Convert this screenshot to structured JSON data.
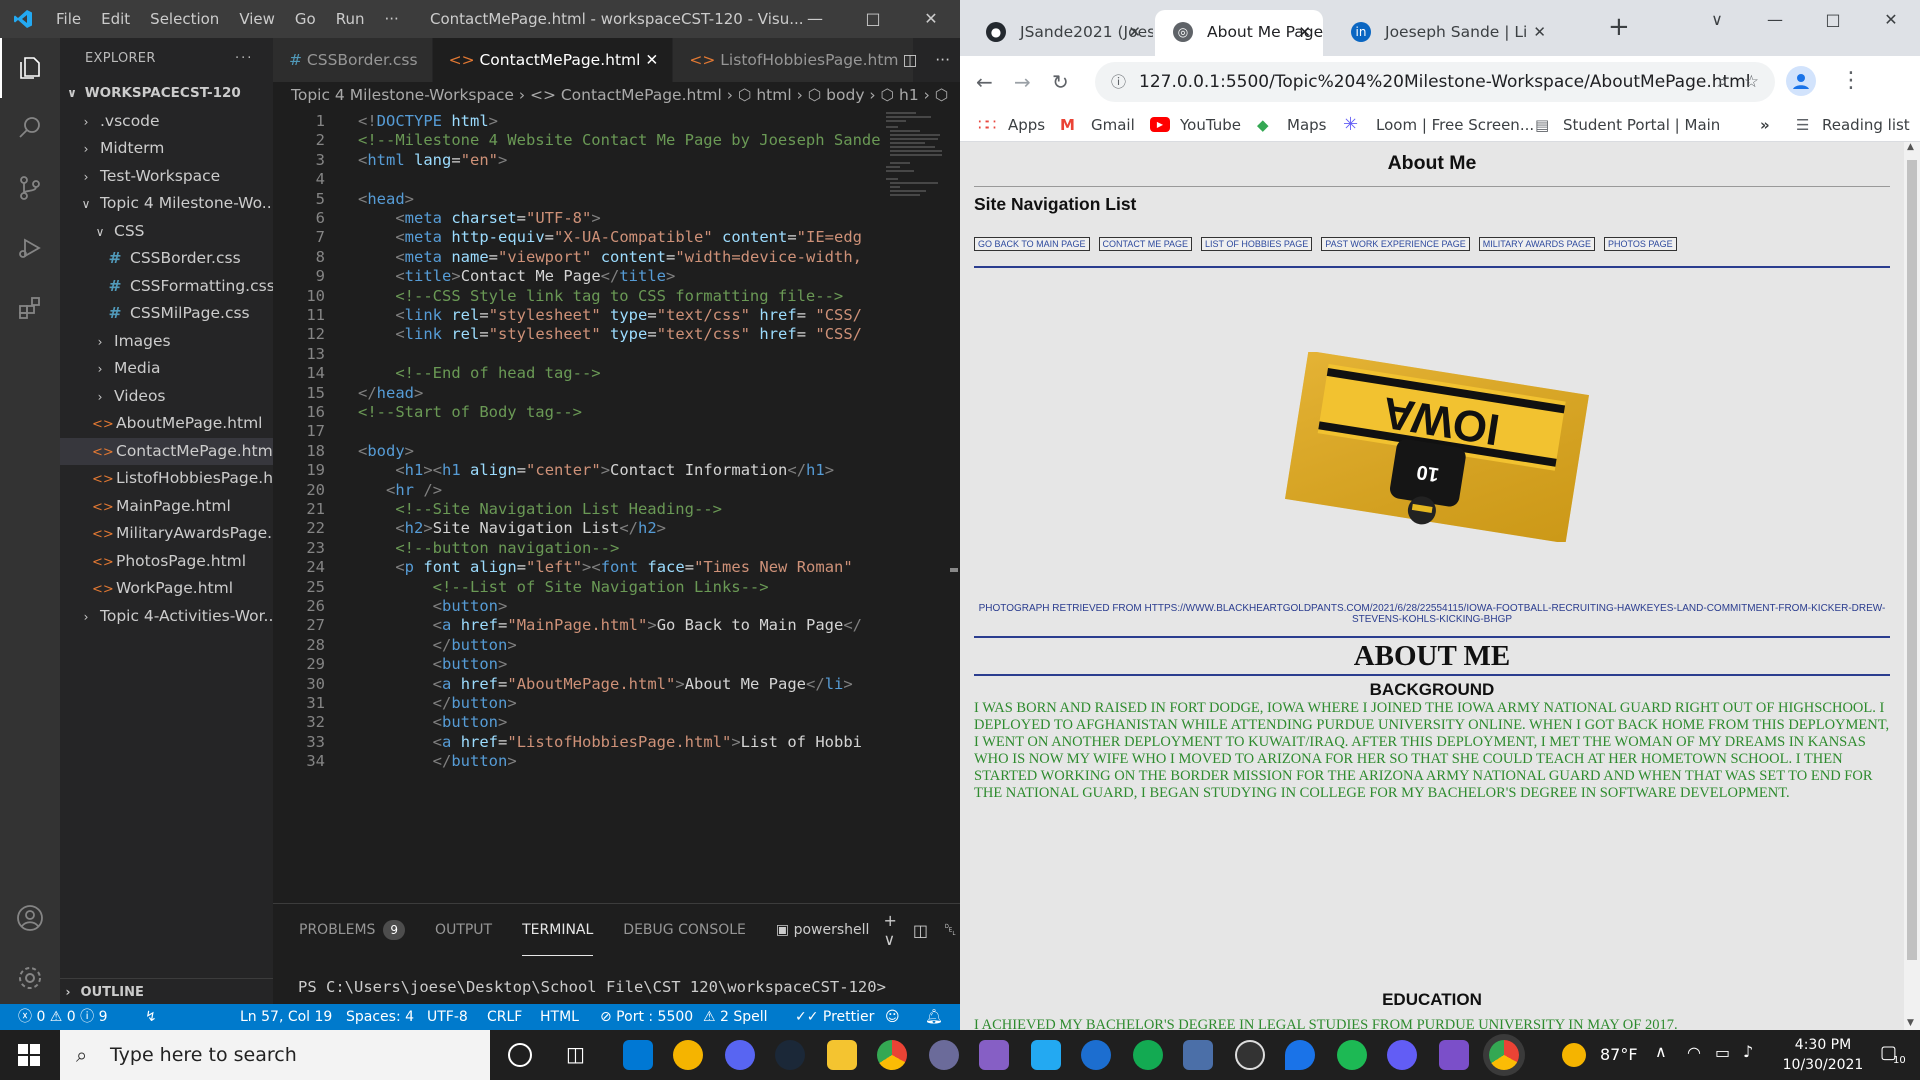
{
  "vscode": {
    "menu": [
      "File",
      "Edit",
      "Selection",
      "View",
      "Go",
      "Run",
      "···"
    ],
    "window_title": "ContactMePage.html - workspaceCST-120 - Visu...",
    "explorer_label": "EXPLORER",
    "workspace": "WORKSPACECST-120",
    "tree": [
      {
        "label": ".vscode",
        "kind": "folder",
        "indent": 0,
        "open": false
      },
      {
        "label": "Midterm",
        "kind": "folder",
        "indent": 0,
        "open": false
      },
      {
        "label": "Test-Workspace",
        "kind": "folder",
        "indent": 0,
        "open": false
      },
      {
        "label": "Topic 4 Milestone-Wo...",
        "kind": "folder",
        "indent": 0,
        "open": true
      },
      {
        "label": "CSS",
        "kind": "folder",
        "indent": 1,
        "open": true
      },
      {
        "label": "CSSBorder.css",
        "kind": "css",
        "indent": 2
      },
      {
        "label": "CSSFormatting.css",
        "kind": "css",
        "indent": 2
      },
      {
        "label": "CSSMilPage.css",
        "kind": "css",
        "indent": 2
      },
      {
        "label": "Images",
        "kind": "folder",
        "indent": 1,
        "open": false
      },
      {
        "label": "Media",
        "kind": "folder",
        "indent": 1,
        "open": false
      },
      {
        "label": "Videos",
        "kind": "folder",
        "indent": 1,
        "open": false
      },
      {
        "label": "AboutMePage.html",
        "kind": "html",
        "indent": 1
      },
      {
        "label": "ContactMePage.html",
        "kind": "html",
        "indent": 1,
        "selected": true
      },
      {
        "label": "ListofHobbiesPage.h...",
        "kind": "html",
        "indent": 1
      },
      {
        "label": "MainPage.html",
        "kind": "html",
        "indent": 1
      },
      {
        "label": "MilitaryAwardsPage....",
        "kind": "html",
        "indent": 1
      },
      {
        "label": "PhotosPage.html",
        "kind": "html",
        "indent": 1
      },
      {
        "label": "WorkPage.html",
        "kind": "html",
        "indent": 1
      },
      {
        "label": "Topic 4-Activities-Wor...",
        "kind": "folder",
        "indent": 0,
        "open": false
      }
    ],
    "outline_label": "OUTLINE",
    "tabs": [
      {
        "label": "CSSBorder.css",
        "icon": "#"
      },
      {
        "label": "ContactMePage.html",
        "icon": "<>",
        "active": true
      },
      {
        "label": "ListofHobbiesPage.htm",
        "icon": "<>"
      }
    ],
    "breadcrumb": "Topic 4 Milestone-Workspace  ›  <> ContactMePage.html  ›  ⬡ html  ›  ⬡ body  ›  ⬡ h1  ›  ⬡",
    "code_lines": [
      {
        "n": "1",
        "h": "<span class='tg'>&lt;!</span><span class='tn'>DOCTYPE</span> <span class='at'>html</span><span class='tg'>&gt;</span>"
      },
      {
        "n": "2",
        "h": "<span class='cm'>&lt;!--Milestone 4 Website Contact Me Page by Joeseph Sande</span>"
      },
      {
        "n": "3",
        "h": "<span class='tg'>&lt;</span><span class='tn'>html</span> <span class='at'>lang</span>=<span class='sv'>\"en\"</span><span class='tg'>&gt;</span>"
      },
      {
        "n": "4",
        "h": ""
      },
      {
        "n": "5",
        "h": "<span class='tg'>&lt;</span><span class='tn'>head</span><span class='tg'>&gt;</span>"
      },
      {
        "n": "6",
        "h": "    <span class='tg'>&lt;</span><span class='tn'>meta</span> <span class='at'>charset</span>=<span class='sv'>\"UTF-8\"</span><span class='tg'>&gt;</span>"
      },
      {
        "n": "7",
        "h": "    <span class='tg'>&lt;</span><span class='tn'>meta</span> <span class='at'>http-equiv</span>=<span class='sv'>\"X-UA-Compatible\"</span> <span class='at'>content</span>=<span class='sv'>\"IE=edg</span>"
      },
      {
        "n": "8",
        "h": "    <span class='tg'>&lt;</span><span class='tn'>meta</span> <span class='at'>name</span>=<span class='sv'>\"viewport\"</span> <span class='at'>content</span>=<span class='sv'>\"width=device-width,</span>"
      },
      {
        "n": "9",
        "h": "    <span class='tg'>&lt;</span><span class='tn'>title</span><span class='tg'>&gt;</span><span class='tx'>Contact Me Page</span><span class='tg'>&lt;/</span><span class='tn'>title</span><span class='tg'>&gt;</span>"
      },
      {
        "n": "10",
        "h": "    <span class='cm'>&lt;!--CSS Style link tag to CSS formatting file--&gt;</span>"
      },
      {
        "n": "11",
        "h": "    <span class='tg'>&lt;</span><span class='tn'>link</span> <span class='at'>rel</span>=<span class='sv'>\"stylesheet\"</span> <span class='at'>type</span>=<span class='sv'>\"text/css\"</span> <span class='at'>href</span>= <span class='sv'>\"CSS/</span>"
      },
      {
        "n": "12",
        "h": "    <span class='tg'>&lt;</span><span class='tn'>link</span> <span class='at'>rel</span>=<span class='sv'>\"stylesheet\"</span> <span class='at'>type</span>=<span class='sv'>\"text/css\"</span> <span class='at'>href</span>= <span class='sv'>\"CSS/</span>"
      },
      {
        "n": "13",
        "h": ""
      },
      {
        "n": "14",
        "h": "    <span class='cm'>&lt;!--End of head tag--&gt;</span>"
      },
      {
        "n": "15",
        "h": "<span class='tg'>&lt;/</span><span class='tn'>head</span><span class='tg'>&gt;</span>"
      },
      {
        "n": "16",
        "h": "<span class='cm'>&lt;!--Start of Body tag--&gt;</span>"
      },
      {
        "n": "17",
        "h": ""
      },
      {
        "n": "18",
        "h": "<span class='tg'>&lt;</span><span class='tn'>body</span><span class='tg'>&gt;</span>"
      },
      {
        "n": "19",
        "h": "    <span class='tg'>&lt;</span><span class='tn'>h1</span><span class='tg'>&gt;&lt;</span><span class='tn'>h1</span> <span class='at'>align</span>=<span class='sv'>\"center\"</span><span class='tg'>&gt;</span><span class='tx'>Contact Information</span><span class='tg'>&lt;/</span><span class='tn'>h1</span><span class='tg'>&gt;</span>"
      },
      {
        "n": "20",
        "h": "   <span class='tg'>&lt;</span><span class='tn'>hr</span> <span class='tg'>/&gt;</span>"
      },
      {
        "n": "21",
        "h": "    <span class='cm'>&lt;!--Site Navigation List Heading--&gt;</span>"
      },
      {
        "n": "22",
        "h": "    <span class='tg'>&lt;</span><span class='tn'>h2</span><span class='tg'>&gt;</span><span class='tx'>Site Navigation List</span><span class='tg'>&lt;/</span><span class='tn'>h2</span><span class='tg'>&gt;</span>"
      },
      {
        "n": "23",
        "h": "    <span class='cm'>&lt;!--button navigation--&gt;</span>"
      },
      {
        "n": "24",
        "h": "    <span class='tg'>&lt;</span><span class='tn'>p</span> <span class='at'>font</span> <span class='at'>align</span>=<span class='sv'>\"left\"</span><span class='tg'>&gt;&lt;</span><span class='tn'>font</span> <span class='at'>face</span>=<span class='sv'>\"Times New Roman\"</span>"
      },
      {
        "n": "25",
        "h": "        <span class='cm'>&lt;!--List of Site Navigation Links--&gt;</span>"
      },
      {
        "n": "26",
        "h": "        <span class='tg'>&lt;</span><span class='tn'>button</span><span class='tg'>&gt;</span>"
      },
      {
        "n": "27",
        "h": "        <span class='tg'>&lt;</span><span class='tn'>a</span> <span class='at'>href</span>=<span class='sv'>\"MainPage.html\"</span><span class='tg'>&gt;</span><span class='tx'>Go Back to Main Page</span><span class='tg'>&lt;/</span>"
      },
      {
        "n": "28",
        "h": "        <span class='tg'>&lt;/</span><span class='tn'>button</span><span class='tg'>&gt;</span>"
      },
      {
        "n": "29",
        "h": "        <span class='tg'>&lt;</span><span class='tn'>button</span><span class='tg'>&gt;</span>"
      },
      {
        "n": "30",
        "h": "        <span class='tg'>&lt;</span><span class='tn'>a</span> <span class='at'>href</span>=<span class='sv'>\"AboutMePage.html\"</span><span class='tg'>&gt;</span><span class='tx'>About Me Page</span><span class='tg'>&lt;/</span><span class='tn'>li</span><span class='tg'>&gt;</span>"
      },
      {
        "n": "31",
        "h": "        <span class='tg'>&lt;/</span><span class='tn'>button</span><span class='tg'>&gt;</span>"
      },
      {
        "n": "32",
        "h": "        <span class='tg'>&lt;</span><span class='tn'>button</span><span class='tg'>&gt;</span>"
      },
      {
        "n": "33",
        "h": "        <span class='tg'>&lt;</span><span class='tn'>a</span> <span class='at'>href</span>=<span class='sv'>\"ListofHobbiesPage.html\"</span><span class='tg'>&gt;</span><span class='tx'>List of Hobbi</span>"
      },
      {
        "n": "34",
        "h": "        <span class='tg'>&lt;/</span><span class='tn'>button</span><span class='tg'>&gt;</span>"
      }
    ],
    "panel_tabs": [
      "PROBLEMS",
      "OUTPUT",
      "TERMINAL",
      "DEBUG CONSOLE"
    ],
    "problems_count": "9",
    "shell": "powershell",
    "terminal_line": "PS C:\\Users\\joese\\Desktop\\School File\\CST 120\\workspaceCST-120>",
    "status": {
      "errors": "ⓧ 0 ⚠ 0 ⓘ 9",
      "position": "Ln 57, Col 19",
      "spaces": "Spaces: 4",
      "encoding": "UTF-8",
      "eol": "CRLF",
      "language": "HTML",
      "port": "⊘ Port : 5500",
      "spell": "⚠ 2 Spell",
      "prettier": "✓✓ Prettier"
    }
  },
  "chrome": {
    "tabs": [
      {
        "label": "JSande2021 (Joese",
        "favicon": "github-icon"
      },
      {
        "label": "About Me Page",
        "favicon": "globe-icon",
        "active": true
      },
      {
        "label": "Joeseph Sande | Li",
        "favicon": "linkedin-icon"
      }
    ],
    "url": "127.0.0.1:5500/Topic%204%20Milestone-Workspace/AboutMePage.html",
    "bookmarks": [
      "Apps",
      "Gmail",
      "YouTube",
      "Maps",
      "Loom | Free Screen...",
      "Student Portal | Main"
    ],
    "reading_list": "Reading list"
  },
  "page": {
    "title": "About Me",
    "nav_heading": "Site Navigation List",
    "nav_buttons": [
      "GO BACK TO MAIN PAGE",
      "CONTACT ME PAGE",
      "LIST OF HOBBIES PAGE",
      "PAST WORK EXPERIENCE PAGE",
      "MILITARY AWARDS PAGE",
      "PHOTOS PAGE"
    ],
    "photo_credit": "PHOTOGRAPH RETRIEVED FROM HTTPS://WWW.BLACKHEARTGOLDPANTS.COM/2021/6/28/22554115/IOWA-FOOTBALL-RECRUITING-HAWKEYES-LAND-COMMITMENT-FROM-KICKER-DREW-STEVENS-KOHLS-KICKING-BHGP",
    "photo_text": "IOWA",
    "jersey_number": "10",
    "about_heading": "ABOUT ME",
    "background_heading": "BACKGROUND",
    "background_text": "I WAS BORN AND RAISED IN FORT DODGE, IOWA WHERE I JOINED THE IOWA ARMY NATIONAL GUARD RIGHT OUT OF HIGHSCHOOL. I DEPLOYED TO AFGHANISTAN WHILE ATTENDING PURDUE UNIVERSITY ONLINE. WHEN I GOT BACK HOME FROM THIS DEPLOYMENT, I WENT ON ANOTHER DEPLOYMENT TO KUWAIT/IRAQ. AFTER THIS DEPLOYMENT, I MET THE WOMAN OF MY DREAMS IN KANSAS WHO IS NOW MY WIFE WHO I MOVED TO ARIZONA FOR HER SO THAT SHE COULD TEACH AT HER HOMETOWN SCHOOL. I THEN STARTED WORKING ON THE BORDER MISSION FOR THE ARIZONA ARMY NATIONAL GUARD AND WHEN THAT WAS SET TO END FOR THE NATIONAL GUARD, I BEGAN STUDYING IN COLLEGE FOR MY BACHELOR'S DEGREE IN SOFTWARE DEVELOPMENT.",
    "education_heading": "EDUCATION",
    "education_text": "I ACHIEVED MY BACHELOR'S DEGREE IN LEGAL STUDIES FROM PURDUE UNIVERSITY IN MAY OF 2017."
  },
  "taskbar": {
    "search_placeholder": "Type here to search",
    "temperature": "87°F",
    "time": "4:30 PM",
    "date": "10/30/2021",
    "notifications": "10"
  }
}
